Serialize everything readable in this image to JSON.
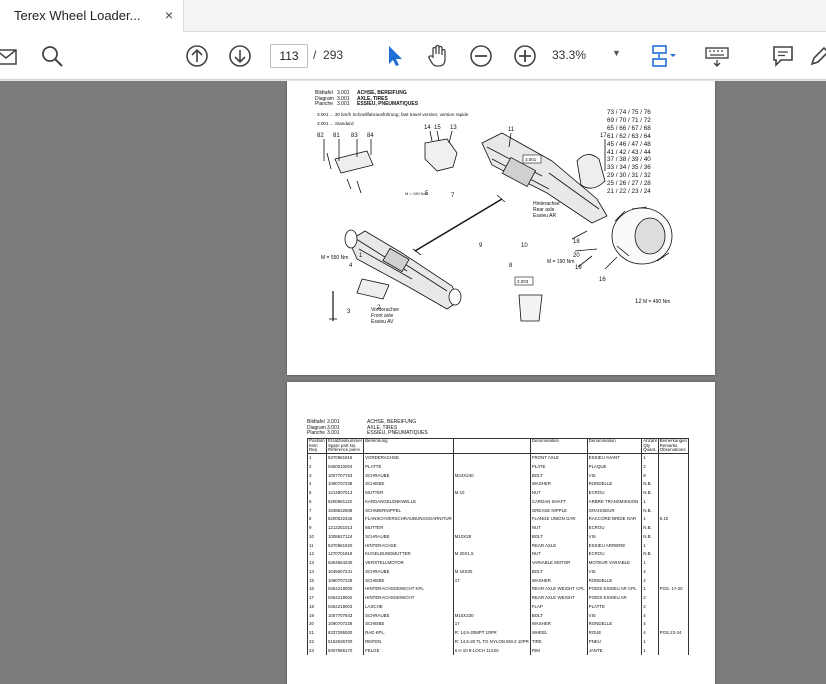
{
  "tab": {
    "title": "Terex Wheel Loader...",
    "close": "×"
  },
  "toolbar": {
    "page_current": "113",
    "page_sep": "/",
    "page_total": "293",
    "zoom": "33.3%"
  },
  "page1": {
    "header": [
      [
        "Bildtafel",
        "3.001",
        "ACHSE, BEREIFUNG"
      ],
      [
        "Diagram",
        "3.001",
        "AXLE, TIRES"
      ],
      [
        "Planche",
        "3.001",
        "ESSIEU, PNEUMATIQUES"
      ]
    ],
    "notes": [
      "3.001 ... 30 km/h Schnellfahrausführung; fast travel version; version rapide",
      "3.001 ... Standard"
    ],
    "grid": [
      "73 / 74 / 75 / 76",
      "69 / 70 / 71 / 72",
      "65 / 66 / 67 / 68",
      "61 / 62 / 63 / 64",
      "45 / 46 / 47 / 48",
      "41 / 42 / 43 / 44",
      "37 / 38 / 39 / 40",
      "33 / 34 / 35 / 36",
      "29 / 30 / 31 / 32",
      "25 / 26 / 27 / 28",
      "21 / 22 / 23 / 24"
    ],
    "callouts": [
      "82",
      "81",
      "83",
      "84",
      "14",
      "15",
      "13",
      "11",
      "17",
      "5",
      "7",
      "8",
      "9",
      "10",
      "18",
      "20",
      "16",
      "19",
      "4",
      "2",
      "3",
      "1",
      "12",
      "3.001",
      "2.003",
      "Hinterachse",
      "Rear axle",
      "Essieu AR",
      "Vorderachse",
      "Front axle",
      "Essieu AV",
      "M = 550 Nm",
      "M = 190 Nm",
      "M = 190 Nm",
      "M = 490 Nm"
    ]
  },
  "page2": {
    "header": [
      [
        "Bildtafel",
        "3.001",
        "ACHSE, BEREIFUNG"
      ],
      [
        "Diagram",
        "3.001",
        "AXLE, TIRES"
      ],
      [
        "Planche",
        "3.001",
        "ESSIEU, PNEUMATIQUES"
      ]
    ],
    "columns": [
      "Position Item Rep.",
      "Ersatzteilnummer Spare part No. Référence pièce",
      "Benennung",
      "",
      "Denomination",
      "Dénomination",
      "Anzahl Qty Quant.",
      "Bemerkungen Remarks Observations"
    ],
    "rows": [
      [
        "1",
        "5370661916",
        "VORDERACHSE",
        "",
        "FRONT AXLE",
        "ESSIEU AVANT",
        "1",
        ""
      ],
      [
        "2",
        "0450010004",
        "PLATTE",
        "",
        "PLATE",
        "PLAQUE",
        "2",
        ""
      ],
      [
        "3",
        "1007707763",
        "SCHRAUBE",
        "M24X240",
        "BOLT",
        "VIS",
        "8",
        ""
      ],
      [
        "4",
        "1090707238",
        "SCHEIBE",
        "",
        "WASHER",
        "RONDELLE",
        "N.B.",
        ""
      ],
      [
        "5",
        "1214907013",
        "MUTTER",
        "M 10",
        "NUT",
        "ECROU",
        "N.B.",
        ""
      ],
      [
        "6",
        "5200661132",
        "KARDANGELENKWELLE",
        "",
        "CARDAN SHAFT",
        "ARBRE TRANSMISSION",
        "1",
        ""
      ],
      [
        "7",
        "1938632608",
        "SCHMIERNIPPEL",
        "",
        "GREASE NIPPLE",
        "GRAISSEUR",
        "N.B.",
        ""
      ],
      [
        "8",
        "5200632425",
        "FLANSCHVERSCHRAUBUNGSGARNITUR",
        "",
        "FLANGE UNION GAR",
        "RACCORD BRIDE GAR",
        "1",
        "8,10"
      ],
      [
        "9",
        "1212251013",
        "MUTTER",
        "",
        "NUT",
        "ECROU",
        "N.B.",
        ""
      ],
      [
        "10",
        "1008627124",
        "SCHRAUBE",
        "M10X28",
        "BOLT",
        "VIS",
        "N.B.",
        ""
      ],
      [
        "11",
        "5370661920",
        "HINTERACHSE",
        "",
        "REAR AXLE",
        "ESSIEU ARRIERE",
        "1",
        ""
      ],
      [
        "12",
        "1270701918",
        "KUGELBUNDMUTTER",
        "M 20X1,5",
        "NUT",
        "ECROU",
        "N.B.",
        ""
      ],
      [
        "13",
        "5354664240",
        "VERSTELLMOTOR",
        "",
        "VARIABLE MOTOR",
        "MOTEUR VARIABLE",
        "1",
        ""
      ],
      [
        "14",
        "1045607241",
        "SCHRAUBE",
        "M 16X30",
        "BOLT",
        "VIS",
        "4",
        ""
      ],
      [
        "15",
        "1090707228",
        "SCHEIBE",
        "17",
        "WASHER",
        "RONDELLE",
        "4",
        ""
      ],
      [
        "16",
        "0454219000",
        "HINTERACHSGEWICHT KPL",
        "",
        "REAR AXLE WEIGHT CPL",
        "POIDS ESSIEU AR CPL",
        "1",
        "POS. 17-20"
      ],
      [
        "17",
        "0454219002",
        "HINTERACHSGEWICHT",
        "",
        "REAR AXLE WEIGHT",
        "POIDS ESSIEU AR",
        "2",
        ""
      ],
      [
        "18",
        "0454219003",
        "LASCHE",
        "",
        "FLAP",
        "PLATTE",
        "2",
        ""
      ],
      [
        "19",
        "1007707843",
        "SCHRAUBE",
        "M16X230",
        "BOLT",
        "VIS",
        "4",
        ""
      ],
      [
        "20",
        "1090707228",
        "SCHEIBE",
        "17",
        "WASHER",
        "RONDELLE",
        "4",
        ""
      ],
      [
        "21",
        "6337295000",
        "RAD KPL.",
        "R: 14,5-20MPT 10PR",
        "WHEEL",
        "ROUE",
        "4",
        "POS.22-24"
      ],
      [
        "22",
        "5152636700",
        "REIFEN",
        "R: 14,5-20 TL TG NYLON EM-2 10PR",
        "TIRE",
        "PNEU",
        "1",
        ""
      ],
      [
        "23",
        "5307586170",
        "FELGE",
        "6 H 10 8-LOCH 11X20",
        "RIM",
        "JANTE",
        "1",
        ""
      ]
    ]
  }
}
